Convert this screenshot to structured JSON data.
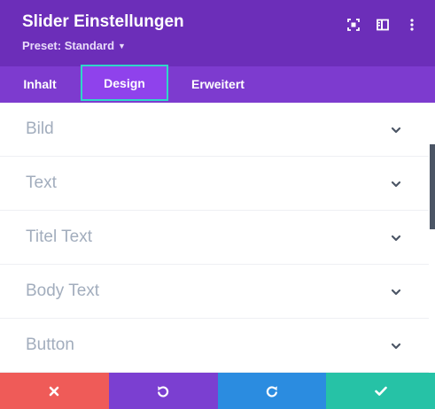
{
  "header": {
    "title": "Slider Einstellungen",
    "preset_label": "Preset: Standard",
    "icons": [
      "expand-icon",
      "sidebar-toggle-icon",
      "more-vertical-icon"
    ]
  },
  "tabs": [
    {
      "label": "Inhalt",
      "active": false
    },
    {
      "label": "Design",
      "active": true
    },
    {
      "label": "Erweitert",
      "active": false
    }
  ],
  "sections": [
    {
      "label": "Bild"
    },
    {
      "label": "Text"
    },
    {
      "label": "Titel Text"
    },
    {
      "label": "Body Text"
    },
    {
      "label": "Button"
    }
  ],
  "footer": {
    "buttons": [
      "cancel",
      "undo",
      "redo",
      "save"
    ]
  },
  "colors": {
    "header": "#6c2eb9",
    "tabs": "#7d3bcf",
    "active_tab": "#8f42ec",
    "active_outline": "#2fd7c8",
    "cancel": "#ef5b58",
    "undo": "#7b3fd1",
    "redo": "#2b8ce0",
    "save": "#26c2a6"
  }
}
